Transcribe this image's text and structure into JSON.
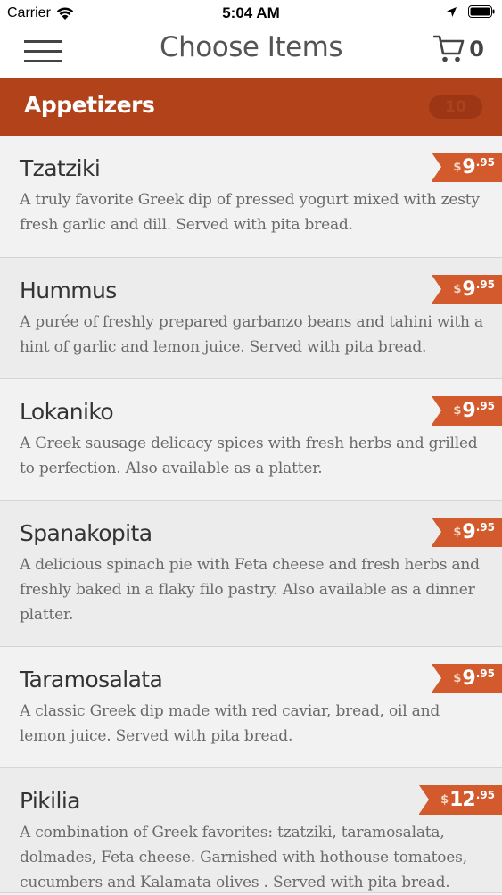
{
  "status_bar": {
    "carrier": "Carrier",
    "time": "5:04 AM"
  },
  "nav": {
    "title": "Choose Items",
    "cart_count": "0"
  },
  "section": {
    "title": "Appetizers",
    "count": "10"
  },
  "items": [
    {
      "name": "Tzatziki",
      "description": "A truly favorite Greek dip of pressed yogurt mixed with zesty fresh garlic and dill. Served with pita bread.",
      "currency": "$",
      "price_int": "9",
      "price_dec": ".95"
    },
    {
      "name": "Hummus",
      "description": "A purée of freshly prepared garbanzo beans and tahini with a hint of garlic and lemon juice. Served with pita bread.",
      "currency": "$",
      "price_int": "9",
      "price_dec": ".95"
    },
    {
      "name": "Lokaniko",
      "description": "A Greek sausage delicacy spices with fresh herbs and grilled to perfection. Also available as a platter.",
      "currency": "$",
      "price_int": "9",
      "price_dec": ".95"
    },
    {
      "name": "Spanakopita",
      "description": "A delicious spinach pie with Feta cheese and fresh herbs and freshly baked in a flaky filo pastry. Also available as a dinner platter.",
      "currency": "$",
      "price_int": "9",
      "price_dec": ".95"
    },
    {
      "name": "Taramosalata",
      "description": "A classic Greek dip made with red caviar, bread, oil and lemon juice. Served with pita bread.",
      "currency": "$",
      "price_int": "9",
      "price_dec": ".95"
    },
    {
      "name": "Pikilia",
      "description": "A combination of Greek favorites: tzatziki, taramosalata, dolmades, Feta cheese. Garnished with hothouse tomatoes, cucumbers and Kalamata olives . Served with pita bread.",
      "currency": "$",
      "price_int": "12",
      "price_dec": ".95"
    }
  ],
  "colors": {
    "accent": "#b24219",
    "price_tag": "#d35a2c"
  }
}
